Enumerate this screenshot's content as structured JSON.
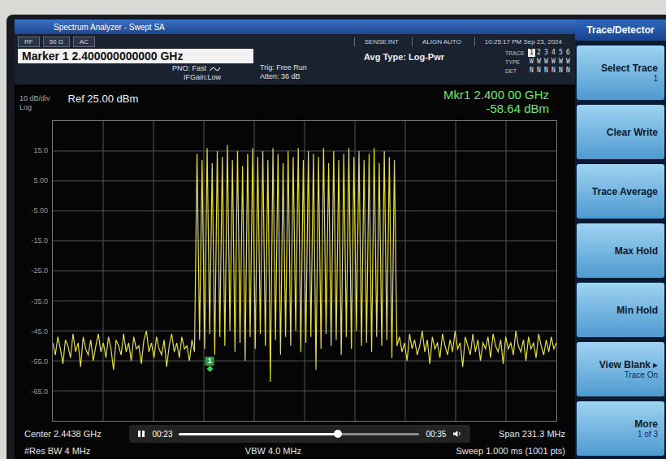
{
  "window": {
    "title": "Spectrum Analyzer - Swept SA"
  },
  "status": {
    "input_tabs": [
      "RF",
      "50 Ω",
      "AC"
    ],
    "sense": "SENSE:INT",
    "align": "ALIGN AUTO",
    "datetime": "10:25:17 PM Sep 23, 2024",
    "marker_field": "Marker 1 2.400000000000 GHz",
    "settings_left": [
      "PNO: Fast",
      "IFGain:Low"
    ],
    "settings_mid": [
      "Trig: Free Run",
      "Atten: 36 dB"
    ],
    "avg_type": "Avg Type: Log-Pwr",
    "trace_table": {
      "trace": {
        "label": "TRACE",
        "cells": [
          {
            "text": "1",
            "selected": true
          },
          {
            "text": "2",
            "selected": false
          },
          {
            "text": "3",
            "selected": false
          },
          {
            "text": "4",
            "selected": false
          },
          {
            "text": "5",
            "selected": false
          },
          {
            "text": "6",
            "selected": false
          }
        ]
      },
      "type": {
        "label": "TYPE",
        "cells": [
          "W",
          "W",
          "W",
          "W",
          "W",
          "W"
        ]
      },
      "det": {
        "label": "DET",
        "cells": [
          "N",
          "N",
          "N",
          "N",
          "N",
          "N"
        ]
      }
    }
  },
  "chart": {
    "scale": "10 dB/div",
    "mode": "Log",
    "reference": "Ref 25.00 dBm",
    "marker_readout": [
      "Mkr1 2.400 00 GHz",
      "-58.64 dBm"
    ],
    "y_range": {
      "min": -75,
      "max": 25
    },
    "y_ticks": [
      "15.0",
      "5.00",
      "-5.00",
      "-15.0",
      "-25.0",
      "-35.0",
      "-45.0",
      "-55.0",
      "-65.0"
    ],
    "series": [
      {
        "name": "Trace 1",
        "values": [
          -49,
          -53,
          -47,
          -51,
          -56,
          -48,
          -50,
          -54,
          -46,
          -52,
          -49,
          -57,
          -47,
          -51,
          -53,
          -48,
          -55,
          -50,
          -46,
          -52,
          -49,
          -54,
          -47,
          -51,
          -58,
          -48,
          -50,
          -53,
          -46,
          -52,
          -49,
          -55,
          -47,
          -51,
          -50,
          -56,
          -48,
          -45,
          -52,
          -49,
          -54,
          -47,
          -51,
          -53,
          -48,
          -57,
          -50,
          -46,
          -52,
          -49,
          -54,
          -47,
          -51,
          -50,
          -55,
          -48,
          -52,
          14,
          -48,
          12,
          -51,
          16,
          -46,
          11,
          -53,
          15,
          -47,
          13,
          -50,
          17,
          -45,
          12,
          -52,
          15,
          -49,
          10,
          -55,
          14,
          -47,
          16,
          -51,
          13,
          -46,
          15,
          -50,
          12,
          -62,
          16,
          -48,
          14,
          -53,
          11,
          -47,
          15,
          -50,
          13,
          -45,
          16,
          -52,
          12,
          -49,
          15,
          -47,
          14,
          -58,
          13,
          -51,
          16,
          -46,
          11,
          -50,
          15,
          -48,
          12,
          -53,
          14,
          -47,
          16,
          -51,
          13,
          -45,
          15,
          -50,
          12,
          -49,
          14,
          -52,
          16,
          -47,
          11,
          -50,
          15,
          -48,
          13,
          -54,
          12,
          -50,
          -47,
          -52,
          -49,
          -55,
          -46,
          -51,
          -48,
          -53,
          -50,
          -45,
          -52,
          -48,
          -56,
          -47,
          -51,
          -49,
          -54,
          -46,
          -50,
          -53,
          -48,
          -52,
          -45,
          -51,
          -49,
          -57,
          -47,
          -50,
          -53,
          -46,
          -52,
          -48,
          -55,
          -49,
          -51,
          -47,
          -54,
          -46,
          -50,
          -52,
          -48,
          -56,
          -47,
          -51,
          -49,
          -53,
          -45,
          -50,
          -52,
          -48,
          -55,
          -47,
          -51,
          -49,
          -54,
          -46,
          -50,
          -53,
          -48,
          -52,
          -47,
          -51,
          -49
        ]
      }
    ],
    "marker": {
      "label": "1",
      "point": 62,
      "value": -58.64
    }
  },
  "player": {
    "elapsed": "00:23",
    "duration": "00:35",
    "level": 0.66,
    "playing": true
  },
  "footer": {
    "center": "Center 2.4438 GHz",
    "span": "Span 231.3 MHz",
    "res_bw": "#Res BW 4 MHz",
    "vbw": "VBW 4.0 MHz",
    "sweep": "Sweep  1.000 ms (1001 pts)"
  },
  "softkeys": {
    "title": "Trace/Detector",
    "items": [
      {
        "label": "Select Trace",
        "sub": "1",
        "arrow": ""
      },
      {
        "label": "Clear Write",
        "sub": "",
        "arrow": ""
      },
      {
        "label": "Trace Average",
        "sub": "",
        "arrow": ""
      },
      {
        "label": "Max Hold",
        "sub": "",
        "arrow": ""
      },
      {
        "label": "Min Hold",
        "sub": "",
        "arrow": ""
      },
      {
        "label": "View Blank",
        "sub": "Trace On",
        "arrow": "▸"
      },
      {
        "label": "More",
        "sub": "1 of 3",
        "arrow": ""
      }
    ]
  }
}
